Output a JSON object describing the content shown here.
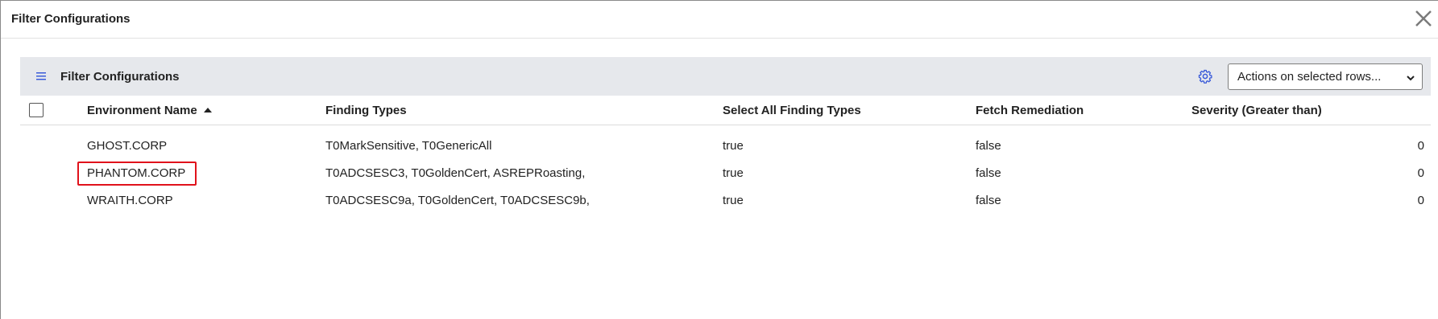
{
  "modal": {
    "title": "Filter Configurations"
  },
  "toolbar": {
    "title": "Filter Configurations",
    "actions_select": "Actions on selected rows..."
  },
  "table": {
    "columns": {
      "environment_name": "Environment Name",
      "finding_types": "Finding Types",
      "select_all_finding_types": "Select All Finding Types",
      "fetch_remediation": "Fetch Remediation",
      "severity": "Severity (Greater than)"
    },
    "rows": [
      {
        "environment_name": "GHOST.CORP",
        "finding_types": "T0MarkSensitive, T0GenericAll",
        "select_all_finding_types": "true",
        "fetch_remediation": "false",
        "severity": "0"
      },
      {
        "environment_name": "PHANTOM.CORP",
        "finding_types": "T0ADCSESC3, T0GoldenCert, ASREPRoasting,",
        "select_all_finding_types": "true",
        "fetch_remediation": "false",
        "severity": "0"
      },
      {
        "environment_name": "WRAITH.CORP",
        "finding_types": "T0ADCSESC9a, T0GoldenCert, T0ADCSESC9b,",
        "select_all_finding_types": "true",
        "fetch_remediation": "false",
        "severity": "0"
      }
    ]
  },
  "colors": {
    "link": "#3a5bd9",
    "toolbar_bg": "#e6e8ec",
    "highlight": "#e0121b"
  },
  "icons": {
    "close": "close-icon",
    "menu": "hamburger-icon",
    "settings": "gear-icon",
    "dropdown": "chevron-down-icon",
    "sort": "sort-ascending-icon"
  }
}
